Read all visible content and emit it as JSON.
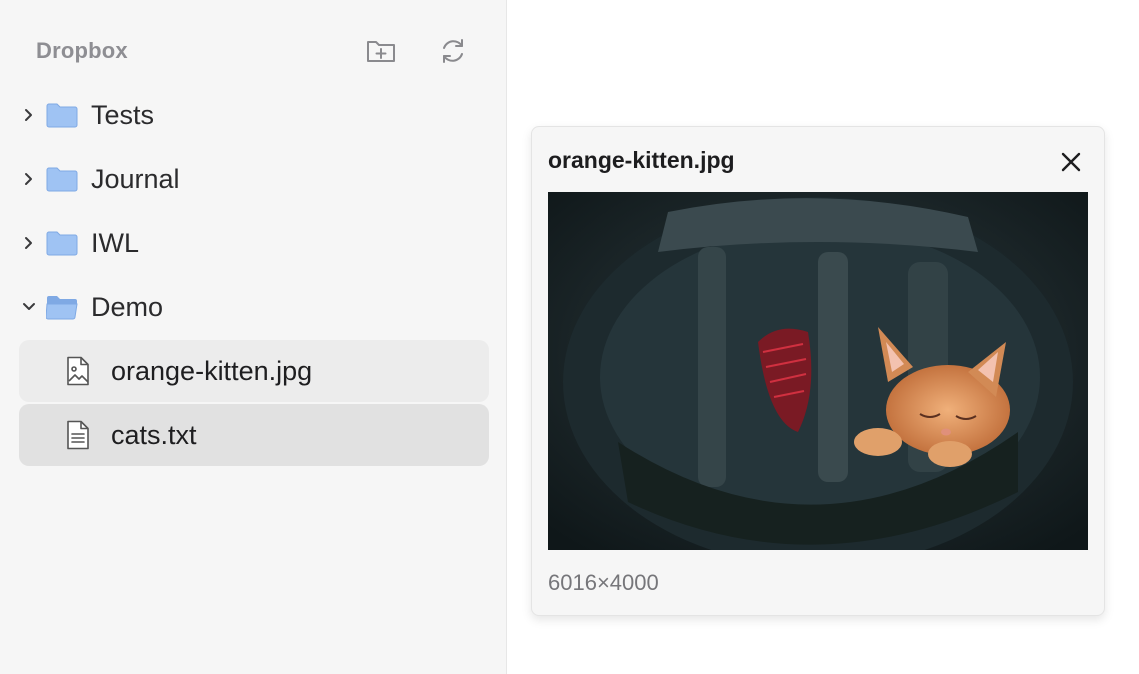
{
  "sidebar": {
    "title": "Dropbox",
    "new_folder_icon": "folder-plus-icon",
    "refresh_icon": "refresh-icon",
    "folders": [
      {
        "label": "Tests",
        "expanded": false
      },
      {
        "label": "Journal",
        "expanded": false
      },
      {
        "label": "IWL",
        "expanded": false
      },
      {
        "label": "Demo",
        "expanded": true
      }
    ],
    "files": [
      {
        "label": "orange-kitten.jpg",
        "icon": "image-file-icon",
        "state": "hover"
      },
      {
        "label": "cats.txt",
        "icon": "text-file-icon",
        "state": "selected"
      }
    ]
  },
  "preview": {
    "title": "orange-kitten.jpg",
    "close_icon": "close-icon",
    "image_alt": "orange kitten sleeping in a camera bag",
    "dimensions": "6016×4000"
  },
  "colors": {
    "folder": "#9fc3f3",
    "sidebar_bg": "#f6f6f6",
    "selected_row": "#e1e1e1",
    "hover_row": "#ececec"
  }
}
